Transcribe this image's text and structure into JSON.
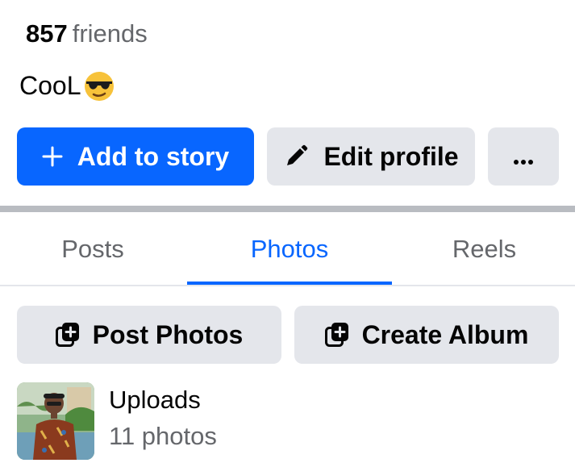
{
  "profile": {
    "friends_count": "857",
    "friends_label": "friends",
    "bio_text": "CooL"
  },
  "actions": {
    "add_story_label": "Add to story",
    "edit_profile_label": "Edit profile",
    "more_label": "···"
  },
  "tabs": [
    {
      "label": "Posts",
      "active": false
    },
    {
      "label": "Photos",
      "active": true
    },
    {
      "label": "Reels",
      "active": false
    }
  ],
  "photos": {
    "post_photos_label": "Post Photos",
    "create_album_label": "Create Album",
    "albums": [
      {
        "title": "Uploads",
        "count": "11 photos"
      }
    ]
  },
  "colors": {
    "accent": "#0866ff",
    "secondary_button": "#e4e6eb",
    "muted_text": "#65676b",
    "primary_text": "#050505"
  },
  "icons": {
    "add_story": "plus-icon",
    "edit": "pencil-icon",
    "more": "ellipsis-icon",
    "post_photos": "add-photos-icon",
    "create_album": "add-album-icon",
    "bio_emoji": "sunglasses-emoji"
  }
}
